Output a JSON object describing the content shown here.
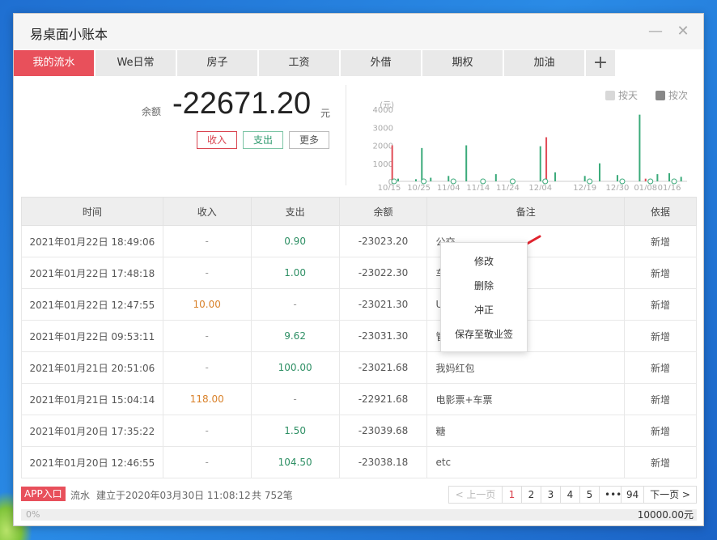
{
  "app": {
    "title": "易桌面小账本",
    "minimize_icon": "—",
    "close_icon": "✕"
  },
  "tabs": [
    "我的流水",
    "We日常",
    "房子",
    "工资",
    "外借",
    "期权",
    "加油"
  ],
  "add_tab_icon": "+",
  "summary": {
    "balance_label": "余额",
    "balance_value": "-22671.20",
    "balance_unit": "元",
    "income_button": "收入",
    "expense_button": "支出",
    "more_button": "更多"
  },
  "chart_data": {
    "type": "line",
    "ylabel": "元",
    "ylim": [
      0,
      4000
    ],
    "y_ticks": [
      "4000",
      "3000",
      "2000",
      "1000",
      "0"
    ],
    "x_ticks": [
      "10/15",
      "10/25",
      "11/04",
      "11/14",
      "11/24",
      "12/04",
      "12/19",
      "12/30",
      "01/08",
      "01/16"
    ],
    "legend": {
      "by_day": "按天",
      "by_count": "按次"
    },
    "colors": {
      "expense": "#3aaa7a",
      "income": "#e14b56",
      "axis": "#aaaaaa"
    },
    "series": [
      {
        "name": "expense",
        "values": [
          {
            "x": "10/15",
            "y": 0
          },
          {
            "x": "10/18",
            "y": 150
          },
          {
            "x": "10/24",
            "y": 120
          },
          {
            "x": "10/26",
            "y": 1850
          },
          {
            "x": "10/29",
            "y": 200
          },
          {
            "x": "11/04",
            "y": 300
          },
          {
            "x": "11/10",
            "y": 2000
          },
          {
            "x": "11/20",
            "y": 400
          },
          {
            "x": "12/04",
            "y": 1950
          },
          {
            "x": "12/09",
            "y": 500
          },
          {
            "x": "12/19",
            "y": 300
          },
          {
            "x": "12/24",
            "y": 1000
          },
          {
            "x": "12/30",
            "y": 350
          },
          {
            "x": "01/06",
            "y": 3700
          },
          {
            "x": "01/12",
            "y": 400
          },
          {
            "x": "01/16",
            "y": 450
          },
          {
            "x": "01/20",
            "y": 250
          }
        ]
      },
      {
        "name": "income",
        "values": [
          {
            "x": "10/16",
            "y": 2000
          },
          {
            "x": "12/06",
            "y": 2450
          },
          {
            "x": "01/08",
            "y": 150
          }
        ]
      }
    ]
  },
  "table": {
    "headers": [
      "时间",
      "收入",
      "支出",
      "余额",
      "备注",
      "依据"
    ],
    "rows": [
      [
        "2021年01月22日 18:49:06",
        "-",
        "0.90",
        "-23023.20",
        "公交",
        "新增"
      ],
      [
        "2021年01月22日 17:48:18",
        "-",
        "1.00",
        "-23022.30",
        "车",
        "新增"
      ],
      [
        "2021年01月22日 12:47:55",
        "10.00",
        "-",
        "-23021.30",
        "U",
        "新增"
      ],
      [
        "2021年01月22日 09:53:11",
        "-",
        "9.62",
        "-23031.30",
        "管",
        "新增"
      ],
      [
        "2021年01月21日 20:51:06",
        "-",
        "100.00",
        "-23021.68",
        "我妈红包",
        "新增"
      ],
      [
        "2021年01月21日 15:04:14",
        "118.00",
        "-",
        "-22921.68",
        "电影票+车票",
        "新增"
      ],
      [
        "2021年01月20日 17:35:22",
        "-",
        "1.50",
        "-23039.68",
        "糖",
        "新增"
      ],
      [
        "2021年01月20日 12:46:55",
        "-",
        "104.50",
        "-23038.18",
        "etc",
        "新增"
      ]
    ]
  },
  "context_menu": [
    "修改",
    "删除",
    "冲正",
    "保存至敬业签"
  ],
  "footer": {
    "app_entry": "APP入口",
    "ledger_name": "流水",
    "created": "建立于2020年03月30日 11:08:12",
    "count": "共 752笔"
  },
  "pager": {
    "prev": "< 上一页",
    "pages": [
      "1",
      "2",
      "3",
      "4",
      "5",
      "•••",
      "94"
    ],
    "next": "下一页 >",
    "current": "1"
  },
  "progress": {
    "percent_label": "0%",
    "fraction": 0.0,
    "total": "10000.00元"
  }
}
